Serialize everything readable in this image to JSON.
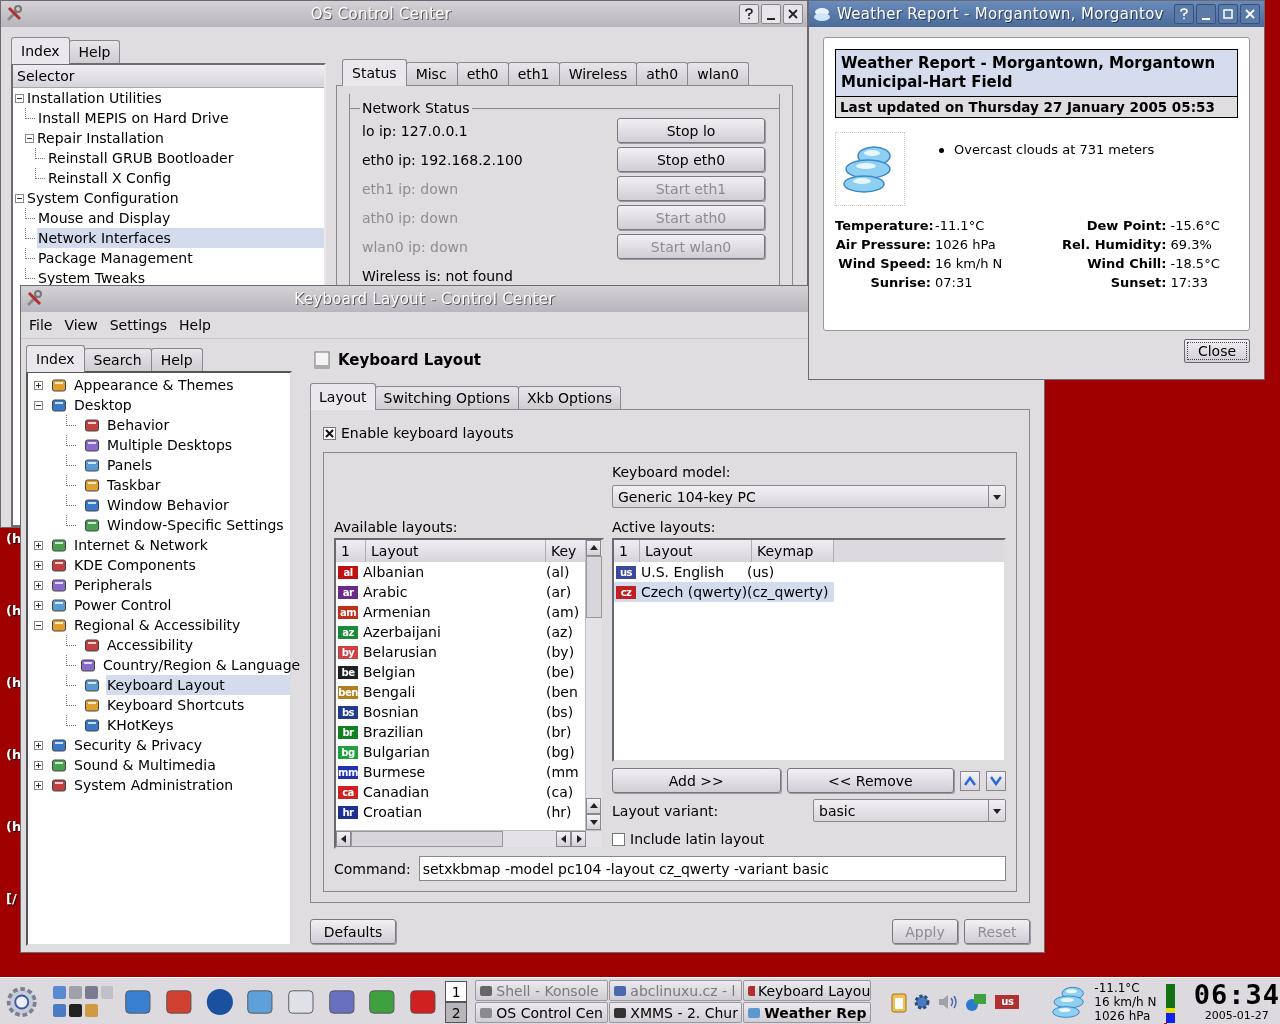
{
  "desktop": {
    "labels": [
      "(h",
      "(h",
      "(h",
      "(h",
      "(h",
      "[/"
    ]
  },
  "os_control_center": {
    "title": "OS Control Center",
    "tabs": [
      {
        "label": "Index",
        "selected": true
      },
      {
        "label": "Help",
        "selected": false
      }
    ],
    "selector_header": "Selector",
    "tree": [
      {
        "label": "Installation Utilities",
        "expanded": true,
        "selected": false,
        "children": [
          {
            "label": "Install MEPIS on Hard Drive",
            "selected": false
          },
          {
            "label": "Repair Installation",
            "expanded": true,
            "selected": false,
            "children": [
              {
                "label": "Reinstall GRUB Bootloader",
                "selected": false
              },
              {
                "label": "Reinstall X Config",
                "selected": false
              }
            ]
          }
        ]
      },
      {
        "label": "System Configuration",
        "expanded": true,
        "selected": false,
        "children": [
          {
            "label": "Mouse and Display",
            "selected": false
          },
          {
            "label": "Network Interfaces",
            "selected": true
          },
          {
            "label": "Package Management",
            "selected": false
          },
          {
            "label": "System Tweaks",
            "selected": false
          }
        ]
      }
    ],
    "net_tabs": [
      {
        "label": "Status",
        "selected": true
      },
      {
        "label": "Misc",
        "selected": false
      },
      {
        "label": "eth0",
        "selected": false
      },
      {
        "label": "eth1",
        "selected": false
      },
      {
        "label": "Wireless",
        "selected": false
      },
      {
        "label": "ath0",
        "selected": false
      },
      {
        "label": "wlan0",
        "selected": false
      }
    ],
    "group_title": "Network Status",
    "interfaces": [
      {
        "status": "lo ip: 127.0.0.1",
        "button": "Stop lo",
        "disabled": false
      },
      {
        "status": "eth0 ip: 192.168.2.100",
        "button": "Stop eth0",
        "disabled": false
      },
      {
        "status": "eth1 ip: down",
        "button": "Start eth1",
        "disabled": true
      },
      {
        "status": "ath0 ip: down",
        "button": "Start ath0",
        "disabled": true
      },
      {
        "status": "wlan0 ip: down",
        "button": "Start wlan0",
        "disabled": true
      }
    ],
    "wireless_status": "Wireless is: not found"
  },
  "keyboard_window": {
    "title": "Keyboard Layout - Control Center",
    "menu": [
      "File",
      "View",
      "Settings",
      "Help"
    ],
    "side_tabs": [
      {
        "label": "Index",
        "selected": true
      },
      {
        "label": "Search",
        "selected": false
      },
      {
        "label": "Help",
        "selected": false
      }
    ],
    "tree": [
      {
        "label": "Appearance & Themes",
        "expanded": false,
        "selected": false
      },
      {
        "label": "Desktop",
        "expanded": true,
        "selected": false,
        "children": [
          {
            "label": "Behavior",
            "selected": false
          },
          {
            "label": "Multiple Desktops",
            "selected": false
          },
          {
            "label": "Panels",
            "selected": false
          },
          {
            "label": "Taskbar",
            "selected": false
          },
          {
            "label": "Window Behavior",
            "selected": false
          },
          {
            "label": "Window-Specific Settings",
            "selected": false
          }
        ]
      },
      {
        "label": "Internet & Network",
        "expanded": false,
        "selected": false
      },
      {
        "label": "KDE Components",
        "expanded": false,
        "selected": false
      },
      {
        "label": "Peripherals",
        "expanded": false,
        "selected": false
      },
      {
        "label": "Power Control",
        "expanded": false,
        "selected": false
      },
      {
        "label": "Regional & Accessibility",
        "expanded": true,
        "selected": false,
        "children": [
          {
            "label": "Accessibility",
            "selected": false
          },
          {
            "label": "Country/Region & Language",
            "selected": false
          },
          {
            "label": "Keyboard Layout",
            "selected": true
          },
          {
            "label": "Keyboard Shortcuts",
            "selected": false
          },
          {
            "label": "KHotKeys",
            "selected": false
          }
        ]
      },
      {
        "label": "Security & Privacy",
        "expanded": false,
        "selected": false
      },
      {
        "label": "Sound & Multimedia",
        "expanded": false,
        "selected": false
      },
      {
        "label": "System Administration",
        "expanded": false,
        "selected": false
      }
    ],
    "module_title": "Keyboard Layout",
    "tabs": [
      {
        "label": "Layout",
        "selected": true
      },
      {
        "label": "Switching Options",
        "selected": false
      },
      {
        "label": "Xkb Options",
        "selected": false
      }
    ],
    "enable": {
      "label": "Enable keyboard layouts",
      "checked": true
    },
    "model": {
      "label": "Keyboard model:",
      "value": "Generic 104-key PC"
    },
    "available": {
      "label": "Available layouts:",
      "columns": [
        "1",
        "Layout",
        "Key"
      ],
      "rows": [
        {
          "flag": "al",
          "name": "Albanian",
          "key": "(al)",
          "color": "#c01010"
        },
        {
          "flag": "ar",
          "name": "Arabic",
          "key": "(ar)",
          "color": "#6a2a8a"
        },
        {
          "flag": "am",
          "name": "Armenian",
          "key": "(am)",
          "color": "#c03018"
        },
        {
          "flag": "az",
          "name": "Azerbaijani",
          "key": "(az)",
          "color": "#1a8a3a"
        },
        {
          "flag": "by",
          "name": "Belarusian",
          "key": "(by)",
          "color": "#d04040"
        },
        {
          "flag": "be",
          "name": "Belgian",
          "key": "(be)",
          "color": "#202020"
        },
        {
          "flag": "ben",
          "name": "Bengali",
          "key": "(ben",
          "color": "#b08020"
        },
        {
          "flag": "bs",
          "name": "Bosnian",
          "key": "(bs)",
          "color": "#203a90"
        },
        {
          "flag": "br",
          "name": "Brazilian",
          "key": "(br)",
          "color": "#108020"
        },
        {
          "flag": "bg",
          "name": "Bulgarian",
          "key": "(bg)",
          "color": "#20a040"
        },
        {
          "flag": "mm",
          "name": "Burmese",
          "key": "(mm",
          "color": "#2030b0"
        },
        {
          "flag": "ca",
          "name": "Canadian",
          "key": "(ca)",
          "color": "#d02020"
        },
        {
          "flag": "hr",
          "name": "Croatian",
          "key": "(hr)",
          "color": "#203090"
        }
      ]
    },
    "active": {
      "label": "Active layouts:",
      "columns": [
        "1",
        "Layout",
        "Keymap"
      ],
      "rows": [
        {
          "flag": "us",
          "name": "U.S. English",
          "key": "(us)",
          "selected": false,
          "color": "#3a4a9a"
        },
        {
          "flag": "cz",
          "name": "Czech (qwerty)",
          "key": "(cz_qwerty)",
          "selected": true,
          "color": "#c02020"
        }
      ]
    },
    "add_button": "Add >>",
    "remove_button": "<< Remove",
    "variant": {
      "label": "Layout variant:",
      "value": "basic"
    },
    "latin": {
      "label": "Include latin layout",
      "checked": false
    },
    "command": {
      "label": "Command:",
      "value": "setxkbmap -model pc104 -layout cz_qwerty -variant basic"
    },
    "buttons": [
      {
        "label": "Defaults",
        "disabled": false
      },
      {
        "label": "Apply",
        "disabled": true
      },
      {
        "label": "Reset",
        "disabled": true
      }
    ]
  },
  "weather_window": {
    "title": "Weather Report - Morgantown, Morgantov",
    "heading": "Weather Report - Morgantown, Morgantown Municipal-Hart Field",
    "updated": "Last updated on Thursday 27 January 2005 05:53",
    "conditions": [
      "Overcast clouds at 731 meters"
    ],
    "stats": [
      {
        "label": "Temperature:",
        "value": "-11.1°C"
      },
      {
        "label": "Dew Point:",
        "value": "-15.6°C"
      },
      {
        "label": "Air Pressure:",
        "value": "1026 hPa"
      },
      {
        "label": "Rel. Humidity:",
        "value": "69.3%"
      },
      {
        "label": "Wind Speed:",
        "value": "16 km/h N"
      },
      {
        "label": "Wind Chill:",
        "value": "-18.5°C"
      },
      {
        "label": "Sunrise:",
        "value": "07:31"
      },
      {
        "label": "Sunset:",
        "value": "17:33"
      }
    ],
    "close_button": "Close"
  },
  "taskbar": {
    "desktops": [
      {
        "label": "1",
        "selected": true
      },
      {
        "label": "2",
        "selected": false
      }
    ],
    "tasks": [
      {
        "label": "Shell - Konsole",
        "minimized": true,
        "active": false
      },
      {
        "label": "abclinuxu.cz - l",
        "minimized": true,
        "active": false
      },
      {
        "label": "Keyboard Layou",
        "minimized": false,
        "active": false
      },
      {
        "label": "OS Control Cen",
        "minimized": false,
        "active": false
      },
      {
        "label": "XMMS - 2. Chur",
        "minimized": false,
        "active": false
      },
      {
        "label": "Weather Rep",
        "minimized": false,
        "active": true
      }
    ],
    "tray_flag": "us",
    "weather": [
      "-11.1°C",
      "16 km/h N",
      "1026 hPa"
    ],
    "clock": "06:34",
    "date": "2005-01-27"
  }
}
